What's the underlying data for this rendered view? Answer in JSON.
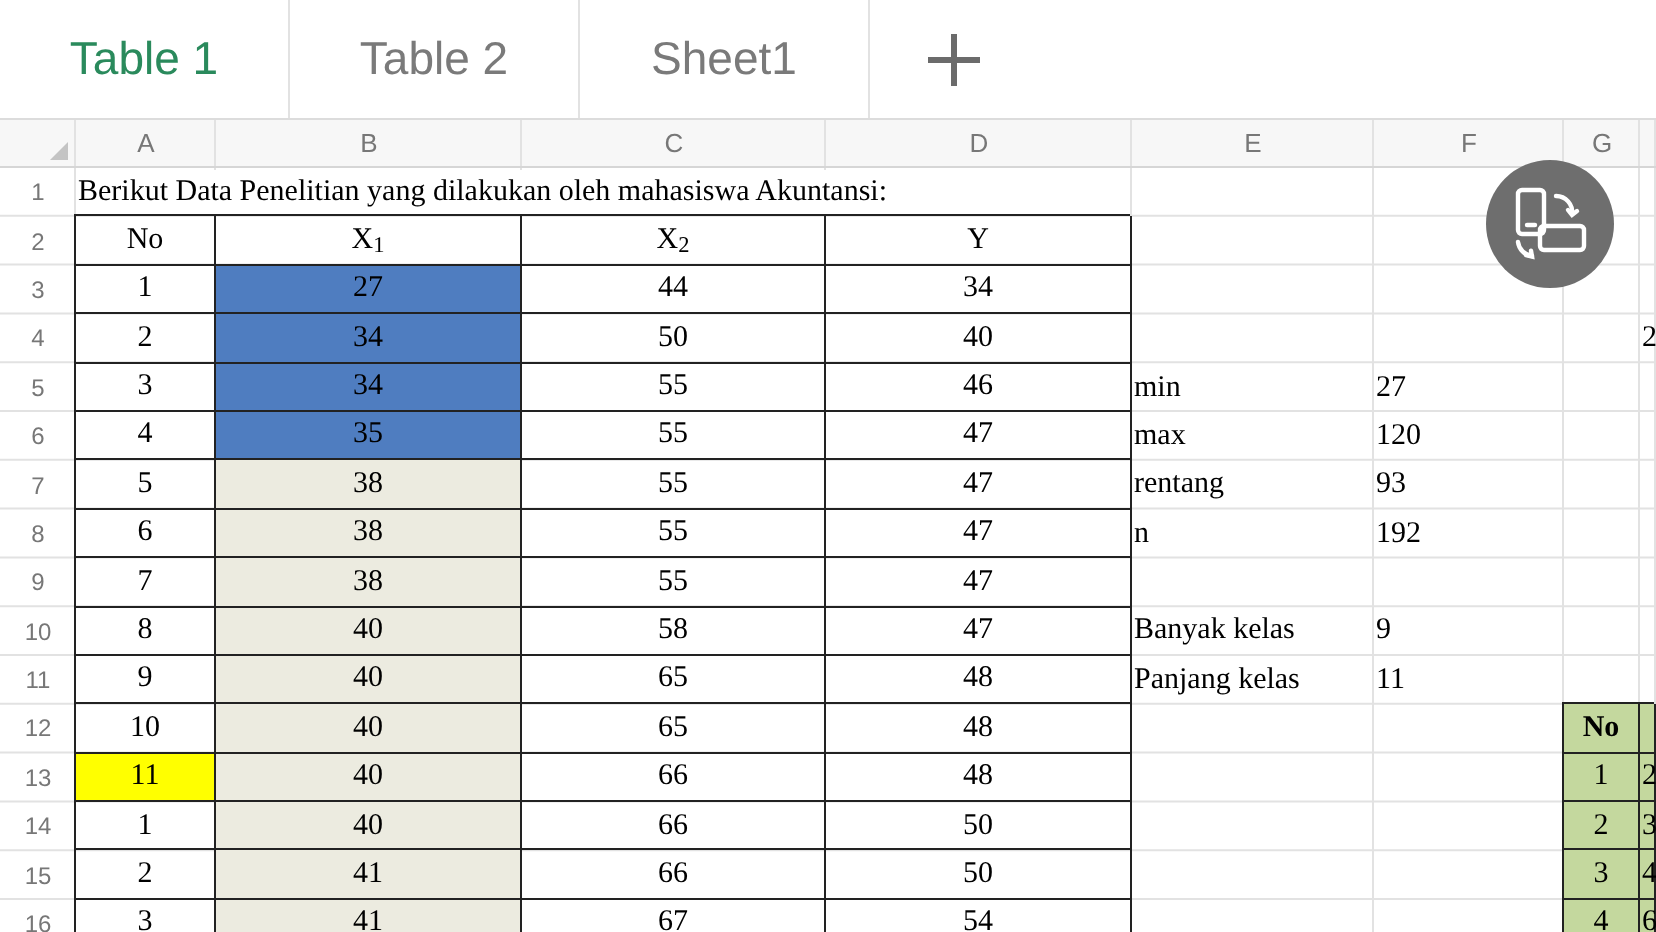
{
  "tabs": [
    {
      "label": "Table 1",
      "selected": true
    },
    {
      "label": "Table 2",
      "selected": false
    },
    {
      "label": "Sheet1",
      "selected": false
    }
  ],
  "column_headers": [
    "A",
    "B",
    "C",
    "D",
    "E",
    "F",
    "G"
  ],
  "rows": [
    {
      "number": "1",
      "cells": {
        "A": {
          "text": "Berikut Data Penelitian yang dilakukan oleh mahasiswa Akuntansi:"
        }
      }
    },
    {
      "number": "2",
      "cells": {
        "A": {
          "text": "No",
          "bordered": true
        },
        "B": {
          "text": "X$_{1}$",
          "bordered": true
        },
        "C": {
          "text": "X$_{2}$",
          "bordered": true
        },
        "D": {
          "text": "Y",
          "bordered": true
        }
      }
    },
    {
      "number": "3",
      "cells": {
        "A": {
          "text": "1",
          "bordered": true
        },
        "B": {
          "text": "27",
          "bordered": true,
          "color": "#4f7dc0"
        },
        "C": {
          "text": "44",
          "bordered": true
        },
        "D": {
          "text": "34",
          "bordered": true
        }
      }
    },
    {
      "number": "4",
      "cells": {
        "A": {
          "text": "2",
          "bordered": true
        },
        "B": {
          "text": "34",
          "bordered": true,
          "color": "#4f7dc0"
        },
        "C": {
          "text": "50",
          "bordered": true
        },
        "D": {
          "text": "40",
          "bordered": true
        },
        "H": {
          "text": "2"
        }
      }
    },
    {
      "number": "5",
      "cells": {
        "A": {
          "text": "3",
          "bordered": true
        },
        "B": {
          "text": "34",
          "bordered": true,
          "color": "#4f7dc0"
        },
        "C": {
          "text": "55",
          "bordered": true
        },
        "D": {
          "text": "46",
          "bordered": true
        },
        "E": {
          "text": "min"
        },
        "F": {
          "text": "27"
        }
      }
    },
    {
      "number": "6",
      "cells": {
        "A": {
          "text": "4",
          "bordered": true
        },
        "B": {
          "text": "35",
          "bordered": true,
          "color": "#4f7dc0"
        },
        "C": {
          "text": "55",
          "bordered": true
        },
        "D": {
          "text": "47",
          "bordered": true
        },
        "E": {
          "text": "max"
        },
        "F": {
          "text": "120"
        }
      }
    },
    {
      "number": "7",
      "cells": {
        "A": {
          "text": "5",
          "bordered": true
        },
        "B": {
          "text": "38",
          "bordered": true,
          "color": "#ecebe0"
        },
        "C": {
          "text": "55",
          "bordered": true
        },
        "D": {
          "text": "47",
          "bordered": true
        },
        "E": {
          "text": "rentang"
        },
        "F": {
          "text": "93"
        }
      }
    },
    {
      "number": "8",
      "cells": {
        "A": {
          "text": "6",
          "bordered": true
        },
        "B": {
          "text": "38",
          "bordered": true,
          "color": "#ecebe0"
        },
        "C": {
          "text": "55",
          "bordered": true
        },
        "D": {
          "text": "47",
          "bordered": true
        },
        "E": {
          "text": "n"
        },
        "F": {
          "text": "192"
        }
      }
    },
    {
      "number": "9",
      "cells": {
        "A": {
          "text": "7",
          "bordered": true
        },
        "B": {
          "text": "38",
          "bordered": true,
          "color": "#ecebe0"
        },
        "C": {
          "text": "55",
          "bordered": true
        },
        "D": {
          "text": "47",
          "bordered": true
        }
      }
    },
    {
      "number": "10",
      "cells": {
        "A": {
          "text": "8",
          "bordered": true
        },
        "B": {
          "text": "40",
          "bordered": true,
          "color": "#ecebe0"
        },
        "C": {
          "text": "58",
          "bordered": true
        },
        "D": {
          "text": "47",
          "bordered": true
        },
        "E": {
          "text": "Banyak kelas"
        },
        "F": {
          "text": "9"
        }
      }
    },
    {
      "number": "11",
      "cells": {
        "A": {
          "text": "9",
          "bordered": true
        },
        "B": {
          "text": "40",
          "bordered": true,
          "color": "#ecebe0"
        },
        "C": {
          "text": "65",
          "bordered": true
        },
        "D": {
          "text": "48",
          "bordered": true
        },
        "E": {
          "text": "Panjang kelas"
        },
        "F": {
          "text": "11"
        }
      }
    },
    {
      "number": "12",
      "cells": {
        "A": {
          "text": "10",
          "bordered": true
        },
        "B": {
          "text": "40",
          "bordered": true,
          "color": "#ecebe0"
        },
        "C": {
          "text": "65",
          "bordered": true
        },
        "D": {
          "text": "48",
          "bordered": true
        },
        "G": {
          "text": "No",
          "bordered": true,
          "bold": true,
          "color": "#c4d89e"
        },
        "H": {
          "bordered": true,
          "color": "#c4d89e"
        }
      }
    },
    {
      "number": "13",
      "cells": {
        "A": {
          "text": "11",
          "bordered": true,
          "color": "#ffff00"
        },
        "B": {
          "text": "40",
          "bordered": true,
          "color": "#ecebe0"
        },
        "C": {
          "text": "66",
          "bordered": true
        },
        "D": {
          "text": "48",
          "bordered": true
        },
        "G": {
          "text": "1",
          "bordered": true,
          "color": "#c4d89e"
        },
        "H": {
          "text": "2",
          "bordered": true,
          "color": "#c4d89e"
        }
      }
    },
    {
      "number": "14",
      "cells": {
        "A": {
          "text": "1",
          "bordered": true
        },
        "B": {
          "text": "40",
          "bordered": true,
          "color": "#ecebe0"
        },
        "C": {
          "text": "66",
          "bordered": true
        },
        "D": {
          "text": "50",
          "bordered": true
        },
        "G": {
          "text": "2",
          "bordered": true,
          "color": "#c4d89e"
        },
        "H": {
          "text": "3",
          "bordered": true,
          "color": "#c4d89e"
        }
      }
    },
    {
      "number": "15",
      "cells": {
        "A": {
          "text": "2",
          "bordered": true
        },
        "B": {
          "text": "41",
          "bordered": true,
          "color": "#ecebe0"
        },
        "C": {
          "text": "66",
          "bordered": true
        },
        "D": {
          "text": "50",
          "bordered": true
        },
        "G": {
          "text": "3",
          "bordered": true,
          "color": "#c4d89e"
        },
        "H": {
          "text": "4",
          "bordered": true,
          "color": "#c4d89e"
        }
      }
    },
    {
      "number": "16",
      "cells": {
        "A": {
          "text": "3",
          "bordered": true
        },
        "B": {
          "text": "41",
          "bordered": true,
          "color": "#ecebe0"
        },
        "C": {
          "text": "67",
          "bordered": true
        },
        "D": {
          "text": "54",
          "bordered": true
        },
        "G": {
          "text": "4",
          "bordered": true,
          "color": "#c4d89e"
        },
        "H": {
          "text": "6",
          "bordered": true,
          "color": "#c4d89e"
        }
      }
    }
  ]
}
